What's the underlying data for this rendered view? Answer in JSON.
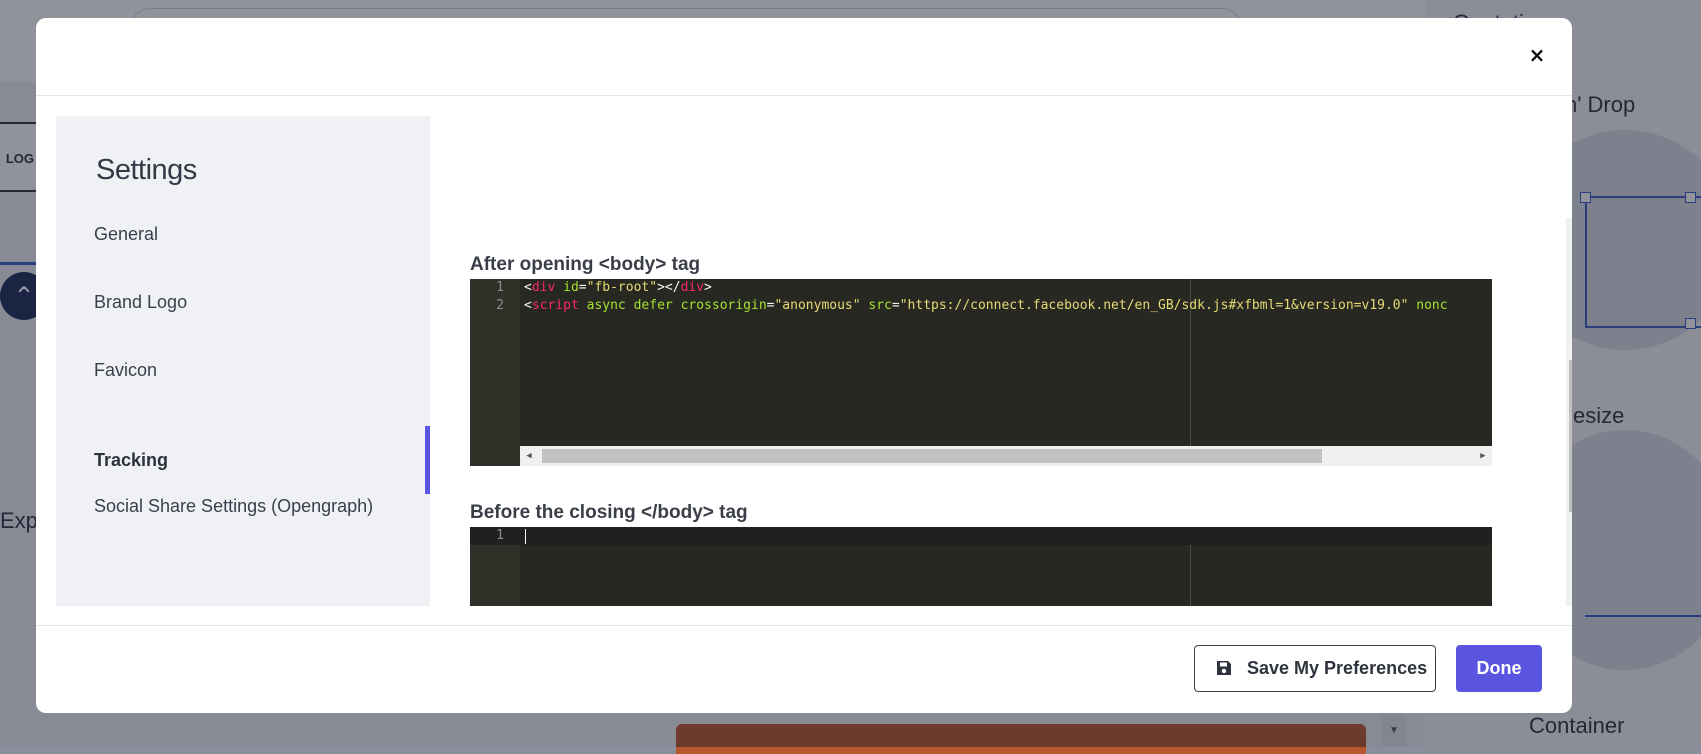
{
  "background": {
    "right_panel_labels": [
      "Quotation",
      "n' Drop",
      "esize",
      "Container"
    ],
    "left_labels": [
      "Expa"
    ],
    "logo_text": "LOG"
  },
  "modal": {
    "close_icon": "×",
    "sidebar": {
      "title": "Settings",
      "items": [
        {
          "label": "General",
          "active": false
        },
        {
          "label": "Brand Logo",
          "active": false
        },
        {
          "label": "Favicon",
          "active": false
        },
        {
          "label": "Tracking",
          "active": true
        },
        {
          "label": "Social Share Settings (Opengraph)",
          "active": false
        }
      ]
    },
    "tracking": {
      "after_body_label": "After opening <body> tag",
      "after_body_code": [
        {
          "line": "1",
          "tokens": [
            {
              "t": "<",
              "c": "tk-txt"
            },
            {
              "t": "div",
              "c": "tk-tag"
            },
            {
              "t": " ",
              "c": "tk-txt"
            },
            {
              "t": "id",
              "c": "tk-attr"
            },
            {
              "t": "=",
              "c": "tk-txt"
            },
            {
              "t": "\"fb-root\"",
              "c": "tk-str"
            },
            {
              "t": "></",
              "c": "tk-txt"
            },
            {
              "t": "div",
              "c": "tk-tag"
            },
            {
              "t": ">",
              "c": "tk-txt"
            }
          ]
        },
        {
          "line": "2",
          "tokens": [
            {
              "t": "<",
              "c": "tk-txt"
            },
            {
              "t": "script",
              "c": "tk-tag"
            },
            {
              "t": " ",
              "c": "tk-txt"
            },
            {
              "t": "async",
              "c": "tk-attr"
            },
            {
              "t": " ",
              "c": "tk-txt"
            },
            {
              "t": "defer",
              "c": "tk-attr"
            },
            {
              "t": " ",
              "c": "tk-txt"
            },
            {
              "t": "crossorigin",
              "c": "tk-attr"
            },
            {
              "t": "=",
              "c": "tk-txt"
            },
            {
              "t": "\"anonymous\"",
              "c": "tk-str"
            },
            {
              "t": " ",
              "c": "tk-txt"
            },
            {
              "t": "src",
              "c": "tk-attr"
            },
            {
              "t": "=",
              "c": "tk-txt"
            },
            {
              "t": "\"https://connect.facebook.net/en_GB/sdk.js#xfbml=1&version=v19.0\"",
              "c": "tk-str"
            },
            {
              "t": " ",
              "c": "tk-txt"
            },
            {
              "t": "nonc",
              "c": "tk-attr"
            }
          ]
        }
      ],
      "before_close_label": "Before the closing </body> tag",
      "before_close_code": [
        {
          "line": "1",
          "tokens": []
        }
      ]
    },
    "footer": {
      "save_label": "Save My Preferences",
      "save_icon": "floppy-disk-icon",
      "done_label": "Done"
    }
  },
  "colors": {
    "accent": "#5a55e0",
    "editor_bg": "#272822"
  }
}
